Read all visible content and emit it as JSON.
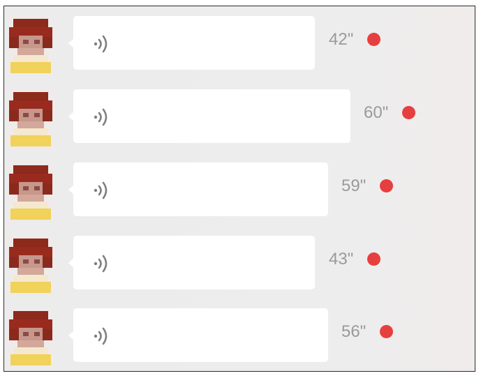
{
  "colors": {
    "bubble": "#ffffff",
    "duration_text": "#9a9a9a",
    "unread_dot": "#e63f3f",
    "background": "#ececec"
  },
  "icons": {
    "avatar": "pixelated-avatar",
    "voice": "voice-wave-icon",
    "unread": "red-dot"
  },
  "messages": [
    {
      "duration": "42\"",
      "unread": true
    },
    {
      "duration": "60\"",
      "unread": true
    },
    {
      "duration": "59\"",
      "unread": true
    },
    {
      "duration": "43\"",
      "unread": true
    },
    {
      "duration": "56\"",
      "unread": true
    }
  ]
}
